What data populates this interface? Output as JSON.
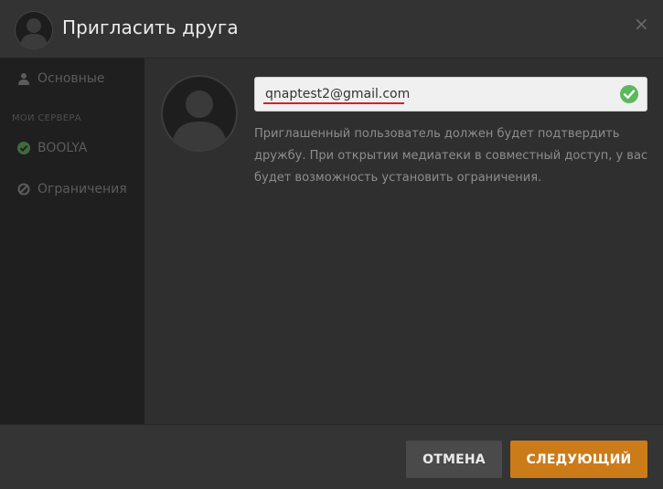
{
  "header": {
    "title": "Пригласить друга",
    "close_glyph": "×"
  },
  "sidebar": {
    "items": [
      {
        "label": "Основные",
        "icon": "user-icon"
      },
      {
        "label": "BOOLYA",
        "icon": "check-circle-icon"
      },
      {
        "label": "Ограничения",
        "icon": "ban-icon"
      }
    ],
    "section_label": "МОИ СЕРВЕРА"
  },
  "form": {
    "email_value": "qnaptest2@gmail.com",
    "email_placeholder": "",
    "help_text": "Приглашенный пользователь должен будет подтвердить дружбу. При открытии медиатеки в совместный доступ, у вас будет возможность установить ограничения."
  },
  "footer": {
    "cancel_label": "ОТМЕНА",
    "next_label": "СЛЕДУЮЩИЙ"
  },
  "colors": {
    "accent": "#cc7b19",
    "valid": "#5cb85c",
    "spellcheck": "#d0212a"
  }
}
